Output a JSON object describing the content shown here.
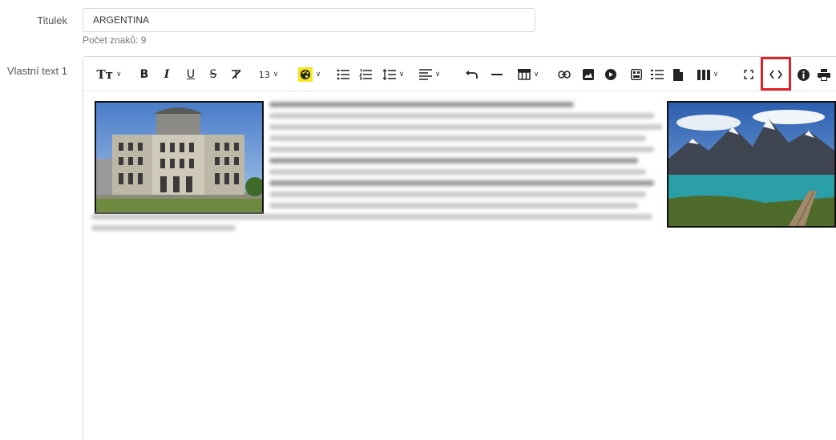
{
  "form": {
    "title_label": "Titulek",
    "title_value": "ARGENTINA",
    "char_count": "Počet znaků: 9",
    "custom_text_label": "Vlastní text 1"
  },
  "toolbar": {
    "font_style": "Tт",
    "bold": "B",
    "italic": "I",
    "underline": "U",
    "strike": "S",
    "font_size": "13",
    "chevron": "∨",
    "highlighted_button": "code-view"
  },
  "colors": {
    "highlight_border": "#e2202a",
    "palette_bg": "#f5e51b",
    "link": "#3b8fd4"
  },
  "icons": [
    "text-style-icon",
    "bold-icon",
    "italic-icon",
    "underline-icon",
    "strikethrough-icon",
    "clear-format-icon",
    "font-size-icon",
    "palette-icon",
    "bullet-list-icon",
    "numbered-list-icon",
    "line-height-icon",
    "align-icon",
    "undo-icon",
    "horizontal-rule-icon",
    "table-icon",
    "link-icon",
    "image-icon",
    "video-icon",
    "template-icon",
    "list-icon",
    "file-icon",
    "columns-icon",
    "fullscreen-icon",
    "code-view-icon",
    "info-icon",
    "print-icon"
  ]
}
